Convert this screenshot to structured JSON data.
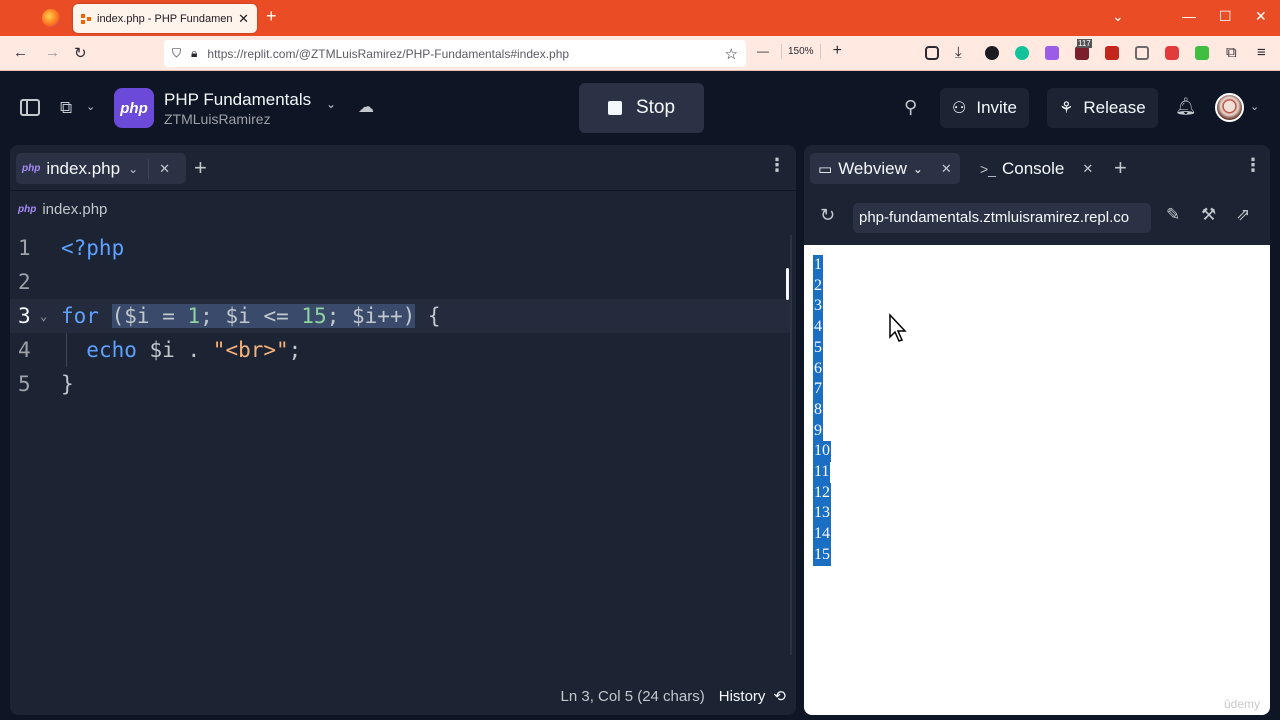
{
  "browser": {
    "tab_title": "index.php - PHP Fundamentals",
    "tab_close": "✕",
    "new_tab": "+",
    "url": "https://replit.com/@ZTMLuisRamirez/PHP-Fundamentals#index.php",
    "zoom_out": "—",
    "zoom_level": "150%",
    "zoom_in": "+",
    "badge_count": "117",
    "win_min": "—",
    "win_max": "☐",
    "win_close": "✕"
  },
  "header": {
    "project_logo": "php",
    "project_name": "PHP Fundamentals",
    "project_owner": "ZTMLuisRamirez",
    "stop_label": "Stop",
    "invite_label": "Invite",
    "release_label": "Release"
  },
  "editor": {
    "tab_label": "index.php",
    "file_icon": "php",
    "breadcrumb": "index.php",
    "lines": [
      {
        "num": "1"
      },
      {
        "num": "2"
      },
      {
        "num": "3"
      },
      {
        "num": "4"
      },
      {
        "num": "5"
      }
    ],
    "status_position": "Ln 3, Col 5 (24 chars)",
    "history_label": "History"
  },
  "webview_pane": {
    "tab_webview": "Webview",
    "tab_console": "Console",
    "address": "php-fundamentals.ztmluisramirez.repl.co",
    "output": [
      "1",
      "2",
      "3",
      "4",
      "5",
      "6",
      "7",
      "8",
      "9",
      "10",
      "11",
      "12",
      "13",
      "14",
      "15"
    ],
    "watermark": "ûdemy"
  },
  "colors": {
    "browser_accent": "#ea4d26",
    "replit_bg": "#0e1525",
    "panel_bg": "#1c2333",
    "selection_blue": "#1a6fc2"
  }
}
